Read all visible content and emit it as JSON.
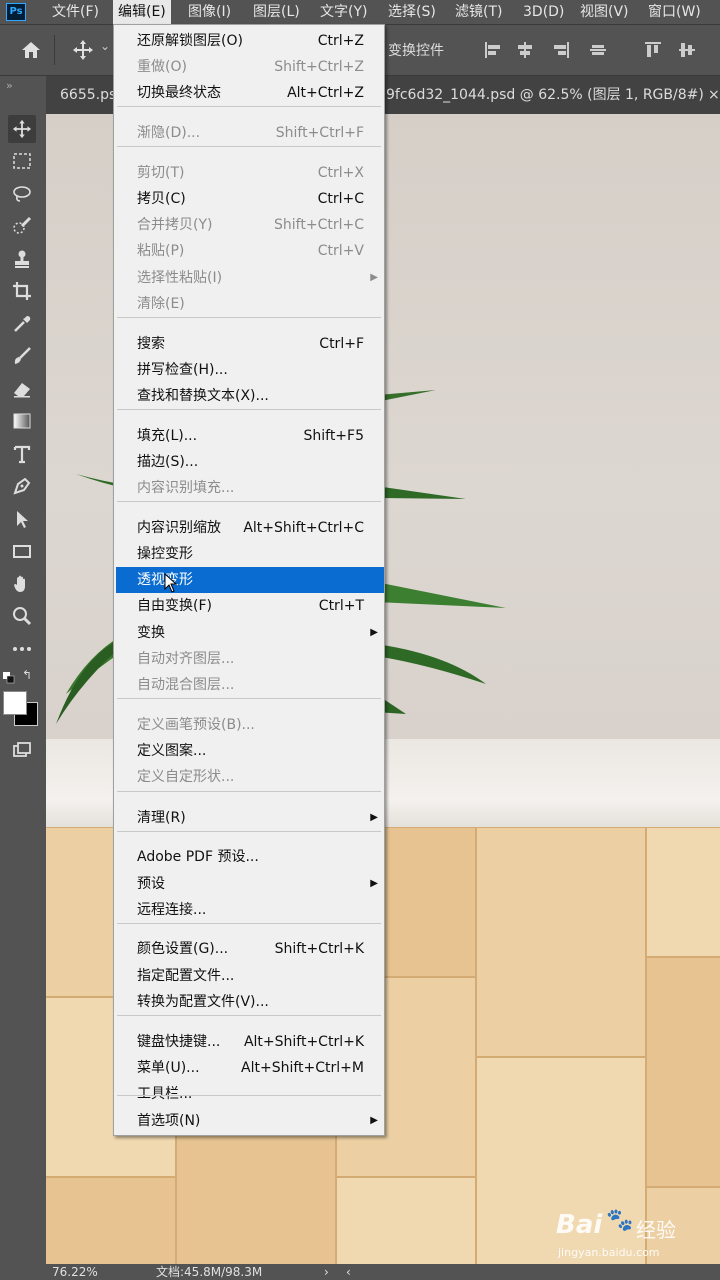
{
  "app": {
    "logo": "Ps"
  },
  "menubar": {
    "items": [
      "文件(F)",
      "编辑(E)",
      "图像(I)",
      "图层(L)",
      "文字(Y)",
      "选择(S)",
      "滤镜(T)",
      "3D(D)",
      "视图(V)",
      "窗口(W)"
    ],
    "active_index": 1
  },
  "options": {
    "transform_label": "变换控件"
  },
  "tabs": {
    "left_tab": "6655.ps",
    "right_tab": "9fc6d32_1044.psd @ 62.5% (图层 1, RGB/8#)",
    "close": "×"
  },
  "collapse": "»",
  "status": {
    "zoom": "76.22%",
    "doc": "文档:45.8M/98.3M"
  },
  "watermark": {
    "brand": "Bai",
    "brand_cn": "经验",
    "url": "jingyan.baidu.com"
  },
  "edit_menu": {
    "items": [
      {
        "label": "还原解锁图层(O)",
        "shortcut": "Ctrl+Z",
        "enabled": true
      },
      {
        "label": "重做(O)",
        "shortcut": "Shift+Ctrl+Z",
        "enabled": false
      },
      {
        "label": "切换最终状态",
        "shortcut": "Alt+Ctrl+Z",
        "enabled": true
      },
      {
        "label": "渐隐(D)...",
        "shortcut": "Shift+Ctrl+F",
        "enabled": false
      },
      {
        "label": "剪切(T)",
        "shortcut": "Ctrl+X",
        "enabled": false
      },
      {
        "label": "拷贝(C)",
        "shortcut": "Ctrl+C",
        "enabled": true
      },
      {
        "label": "合并拷贝(Y)",
        "shortcut": "Shift+Ctrl+C",
        "enabled": false
      },
      {
        "label": "粘贴(P)",
        "shortcut": "Ctrl+V",
        "enabled": false
      },
      {
        "label": "选择性粘贴(I)",
        "shortcut": "",
        "enabled": false,
        "submenu": true
      },
      {
        "label": "清除(E)",
        "shortcut": "",
        "enabled": false
      },
      {
        "label": "搜索",
        "shortcut": "Ctrl+F",
        "enabled": true
      },
      {
        "label": "拼写检查(H)...",
        "shortcut": "",
        "enabled": true
      },
      {
        "label": "查找和替换文本(X)...",
        "shortcut": "",
        "enabled": true
      },
      {
        "label": "填充(L)...",
        "shortcut": "Shift+F5",
        "enabled": true
      },
      {
        "label": "描边(S)...",
        "shortcut": "",
        "enabled": true
      },
      {
        "label": "内容识别填充...",
        "shortcut": "",
        "enabled": false
      },
      {
        "label": "内容识别缩放",
        "shortcut": "Alt+Shift+Ctrl+C",
        "enabled": true
      },
      {
        "label": "操控变形",
        "shortcut": "",
        "enabled": true
      },
      {
        "label": "透视变形",
        "shortcut": "",
        "enabled": true,
        "highlighted": true
      },
      {
        "label": "自由变换(F)",
        "shortcut": "Ctrl+T",
        "enabled": true
      },
      {
        "label": "变换",
        "shortcut": "",
        "enabled": true,
        "submenu": true
      },
      {
        "label": "自动对齐图层...",
        "shortcut": "",
        "enabled": false
      },
      {
        "label": "自动混合图层...",
        "shortcut": "",
        "enabled": false
      },
      {
        "label": "定义画笔预设(B)...",
        "shortcut": "",
        "enabled": false
      },
      {
        "label": "定义图案...",
        "shortcut": "",
        "enabled": true
      },
      {
        "label": "定义自定形状...",
        "shortcut": "",
        "enabled": false
      },
      {
        "label": "清理(R)",
        "shortcut": "",
        "enabled": true,
        "submenu": true
      },
      {
        "label": "Adobe PDF 预设...",
        "shortcut": "",
        "enabled": true
      },
      {
        "label": "预设",
        "shortcut": "",
        "enabled": true,
        "submenu": true
      },
      {
        "label": "远程连接...",
        "shortcut": "",
        "enabled": true
      },
      {
        "label": "颜色设置(G)...",
        "shortcut": "Shift+Ctrl+K",
        "enabled": true
      },
      {
        "label": "指定配置文件...",
        "shortcut": "",
        "enabled": true
      },
      {
        "label": "转换为配置文件(V)...",
        "shortcut": "",
        "enabled": true
      },
      {
        "label": "键盘快捷键...",
        "shortcut": "Alt+Shift+Ctrl+K",
        "enabled": true
      },
      {
        "label": "菜单(U)...",
        "shortcut": "Alt+Shift+Ctrl+M",
        "enabled": true
      },
      {
        "label": "工具栏...",
        "shortcut": "",
        "enabled": true
      },
      {
        "label": "首选项(N)",
        "shortcut": "",
        "enabled": true,
        "submenu": true
      }
    ]
  }
}
